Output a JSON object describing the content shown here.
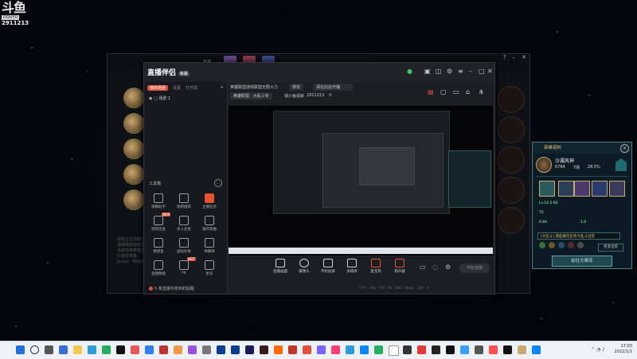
{
  "overlay": {
    "brand": "斗鱼",
    "brand_sub": "DOUYU",
    "room_id": "2911213"
  },
  "lol_client": {
    "header_text": "可用",
    "chat_lines": [
      "游戏正在加载中…",
      "请等待其他玩家选择英雄",
      "当前可用英雄数 164",
      "已锁定英雄",
      "Jessie：哈哈哈"
    ]
  },
  "app": {
    "name": "直播伴侣",
    "version": "新版",
    "sidebar": {
      "tabs": [
        "我的场景",
        "设置",
        "打开源"
      ],
      "scene_label": "场景 1",
      "tools_heading": "工具箱",
      "tools": [
        {
          "label": "弹幕助手",
          "badge": ""
        },
        {
          "label": "观看推荐",
          "badge": ""
        },
        {
          "label": "主播任务",
          "badge": ""
        },
        {
          "label": "视频连麦",
          "badge": "NEW"
        },
        {
          "label": "多人连麦",
          "badge": ""
        },
        {
          "label": "推荐歌曲",
          "badge": ""
        },
        {
          "label": "摸摸鱼",
          "badge": ""
        },
        {
          "label": "虚拟形象",
          "badge": ""
        },
        {
          "label": "弹幕库",
          "badge": ""
        },
        {
          "label": "直播数据",
          "badge": ""
        },
        {
          "label": "PK",
          "badge": "HOT"
        },
        {
          "label": "更多",
          "badge": ""
        }
      ],
      "footer": "5 条直播中收到的提醒"
    },
    "stream": {
      "title": "英雄联盟游戏联盟无限火力",
      "edit_label": "修改",
      "announcement": "请在此处开播",
      "category": "英雄联盟 · 大乱斗专",
      "stat1": "钱小鱼成就",
      "room": "2911213",
      "fans": "0"
    },
    "toolbar": [
      {
        "label": "直播画面",
        "icon": "screen-icon"
      },
      {
        "label": "摄像头",
        "icon": "camera-icon"
      },
      {
        "label": "手机投屏",
        "icon": "phone-icon"
      },
      {
        "label": "多媒体",
        "icon": "media-icon"
      },
      {
        "label": "麦克风",
        "icon": "mic-icon"
      },
      {
        "label": "扬声器",
        "icon": "speaker-icon"
      }
    ],
    "start_button": "开始直播",
    "status_items": [
      "CPU：18%",
      "FPS：60",
      "码率：0kbps",
      "丢帧：0"
    ]
  },
  "panel": {
    "title": "英雄资料",
    "player": "沙漏风神",
    "stats": [
      "6784",
      "7场",
      "28.5%"
    ],
    "items": [
      "Lv.14 2.64",
      "75",
      "0.64",
      "1.0"
    ],
    "dropdown": "[大乱斗] 典型最佳出装大乱斗出装",
    "more": "更多出装",
    "button": "前往文案库"
  },
  "taskbar": {
    "time": "17:03",
    "date": "2022/1/1"
  }
}
